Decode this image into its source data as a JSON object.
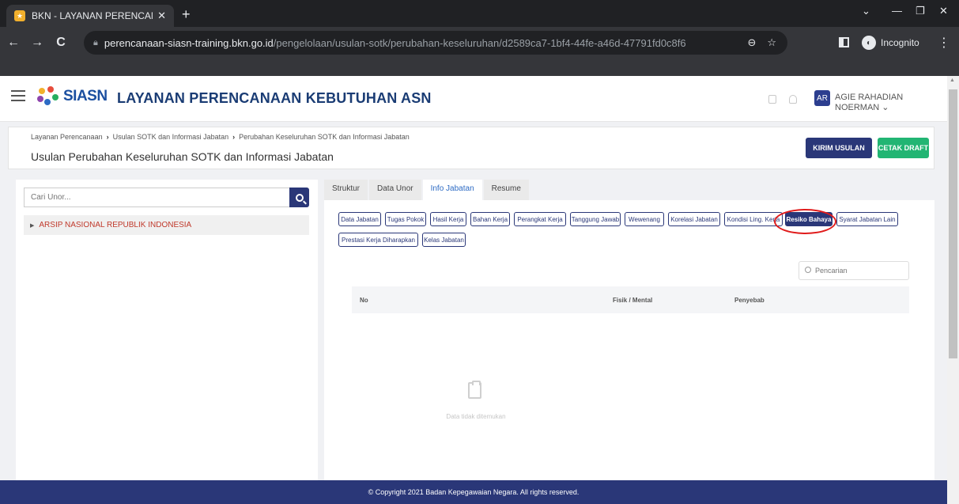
{
  "browser": {
    "tab_title": "BKN - LAYANAN PERENCANAAN",
    "tab_close": "✕",
    "new_tab": "+",
    "url_host": "perencanaan-siasn-training.bkn.go.id",
    "url_path": "/pengelolaan/usulan-sotk/perubahan-keseluruhan/d2589ca7-1bf4-44fe-a46d-47791fd0c8f6",
    "incognito_label": "Incognito",
    "nav_back": "←",
    "nav_forward": "→",
    "nav_reload": "C",
    "win_minimize": "—",
    "win_restore": "❐",
    "win_close": "✕",
    "win_dropdown": "⌄",
    "zoom_icon": "⊖",
    "star_icon": "☆",
    "menu_icon": "⋮"
  },
  "header": {
    "logo_text": "SIASN",
    "app_title": "LAYANAN PERENCANAAN KEBUTUHAN ASN",
    "avatar_initials": "AR",
    "username": "AGIE RAHADIAN NOERMAN ⌄"
  },
  "breadcrumb": {
    "items": [
      "Layanan Perencanaan",
      "Usulan SOTK dan Informasi Jabatan",
      "Perubahan Keseluruhan SOTK dan Informasi Jabatan"
    ],
    "separator": "›"
  },
  "page": {
    "title": "Usulan Perubahan Keseluruhan SOTK dan Informasi Jabatan",
    "kirim_label": "KIRIM USULAN",
    "cetak_label": "CETAK DRAFT"
  },
  "left": {
    "search_placeholder": "Cari Unor...",
    "tree_items": [
      "ARSIP NASIONAL REPUBLIK INDONESIA"
    ]
  },
  "tabs": [
    "Struktur",
    "Data Unor",
    "Info Jabatan",
    "Resume"
  ],
  "sub_buttons": [
    "Data Jabatan",
    "Tugas Pokok",
    "Hasil Kerja",
    "Bahan Kerja",
    "Perangkat Kerja",
    "Tanggung Jawab",
    "Wewenang",
    "Korelasi Jabatan",
    "Kondisi Ling. Kerja",
    "Resiko Bahaya",
    "Syarat Jabatan Lain",
    "Prestasi Kerja Diharapkan",
    "Kelas Jabatan"
  ],
  "table": {
    "search_placeholder": "Pencarian",
    "columns": [
      "No",
      "Fisik / Mental",
      "Penyebab"
    ],
    "empty_text": "Data tidak ditemukan"
  },
  "footer": {
    "copyright": "© Copyright 2021 Badan Kepegawaian Negara. All rights reserved."
  },
  "colors": {
    "primary": "#2a3778",
    "success": "#22b573",
    "highlight_circle": "#e01b1b"
  }
}
